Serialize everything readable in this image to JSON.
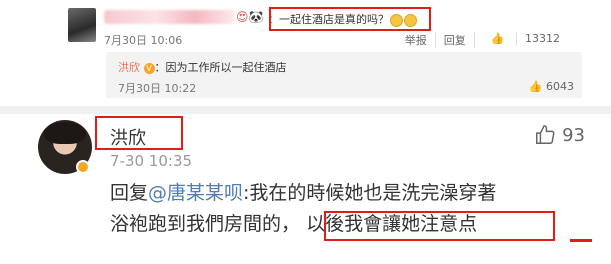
{
  "top_comment": {
    "text": "：一起住酒店是真的吗？",
    "time": "7月30日 10:06",
    "actions": [
      "举报",
      "回复",
      "13312"
    ]
  },
  "top_reply": {
    "author": "洪欣",
    "text": "：因为工作所以一起住酒店",
    "time": "7月30日 10:22",
    "likes": "6043"
  },
  "main_comment": {
    "author": "洪欣",
    "time": "7-30 10:35",
    "likes": "93",
    "reply_prefix": "回复",
    "mention": "@唐某某呗",
    "text_a": ":我在的時候她也是洗完澡穿著",
    "text_b": "浴袍跑到我們房間的，",
    "text_highlight": "以後我會讓她注意点"
  },
  "colors": {
    "highlight_red": "#e21b1b",
    "mention_blue": "#507daf",
    "name_orange": "#eb7350"
  }
}
